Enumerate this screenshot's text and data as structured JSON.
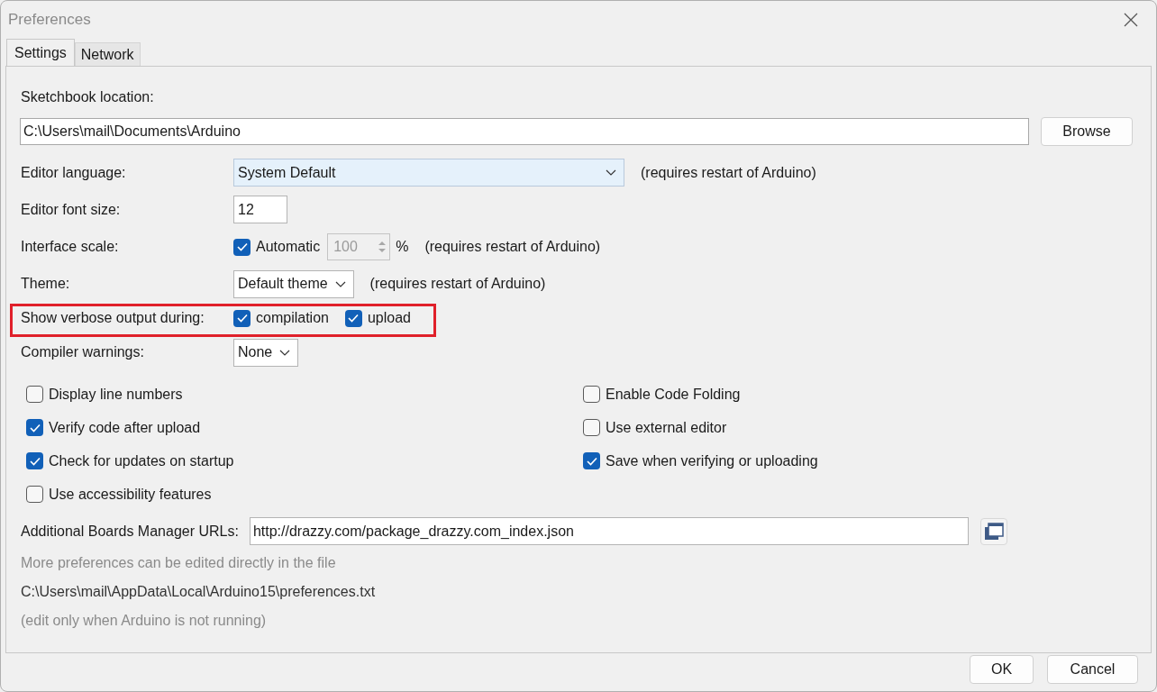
{
  "window": {
    "title": "Preferences"
  },
  "tabs": [
    {
      "label": "Settings",
      "selected": true
    },
    {
      "label": "Network",
      "selected": false
    }
  ],
  "sketchbook": {
    "label": "Sketchbook location:",
    "value": "C:\\Users\\mail\\Documents\\Arduino",
    "button": "Browse"
  },
  "rows": [
    {
      "kind": "select",
      "label": "Editor language:",
      "value": "System Default",
      "focused": true,
      "note": "(requires restart of Arduino)"
    },
    {
      "kind": "text",
      "label": "Editor font size:",
      "value": "12"
    },
    {
      "kind": "scale",
      "label": "Interface scale:",
      "check_label": "Automatic",
      "checked": true,
      "value": "100",
      "unit": "%",
      "note": "(requires restart of Arduino)"
    },
    {
      "kind": "select",
      "label": "Theme:",
      "value": "Default theme",
      "focused": false,
      "note": "(requires restart of Arduino)"
    },
    {
      "kind": "checks",
      "label": "Show verbose output during:",
      "highlighted": true,
      "options": [
        {
          "label": "compilation",
          "checked": true
        },
        {
          "label": "upload",
          "checked": true
        }
      ]
    },
    {
      "kind": "select",
      "label": "Compiler warnings:",
      "value": "None",
      "focused": false
    }
  ],
  "options_left": [
    {
      "label": "Display line numbers",
      "checked": false
    },
    {
      "label": "Verify code after upload",
      "checked": true
    },
    {
      "label": "Check for updates on startup",
      "checked": true
    },
    {
      "label": "Use accessibility features",
      "checked": false
    }
  ],
  "options_right": [
    {
      "label": "Enable Code Folding",
      "checked": false
    },
    {
      "label": "Use external editor",
      "checked": false
    },
    {
      "label": "Save when verifying or uploading",
      "checked": true
    }
  ],
  "boards_urls": {
    "label": "Additional Boards Manager URLs:",
    "value": "http://drazzy.com/package_drazzy.com_index.json"
  },
  "footer": [
    "More preferences can be edited directly in the file",
    "C:\\Users\\mail\\AppData\\Local\\Arduino15\\preferences.txt",
    "(edit only when Arduino is not running)"
  ],
  "buttons": [
    "OK",
    "Cancel"
  ]
}
